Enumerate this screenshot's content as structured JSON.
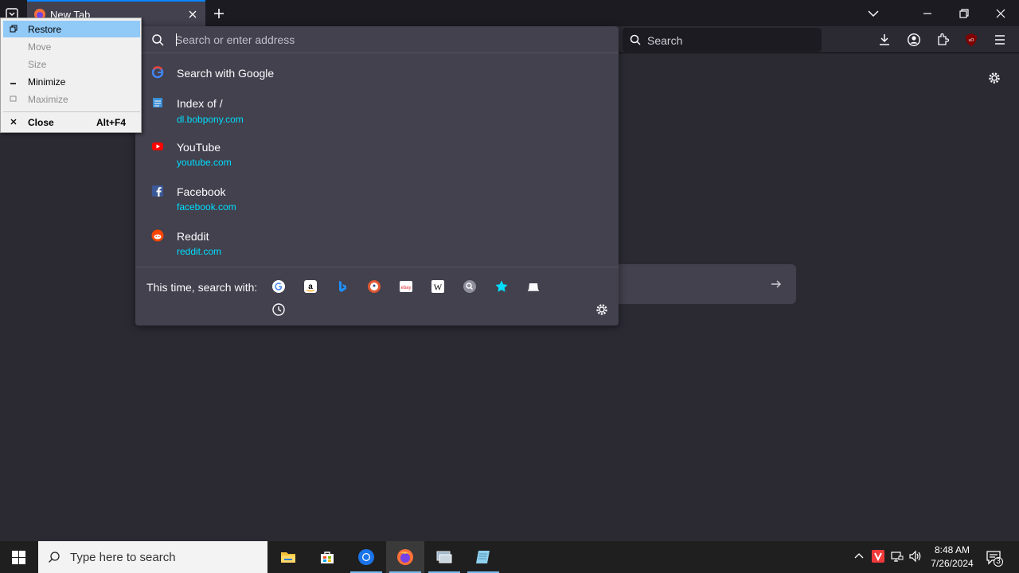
{
  "browser": {
    "tab": {
      "title": "New Tab"
    },
    "toolbar": {
      "search_placeholder": "Search"
    }
  },
  "urlbar": {
    "placeholder": "Search or enter address",
    "results": [
      {
        "title": "Search with Google",
        "url": "",
        "icon": "google-icon"
      },
      {
        "title": "Index of /",
        "url": "dl.bobpony.com",
        "icon": "page-icon"
      },
      {
        "title": "YouTube",
        "url": "youtube.com",
        "icon": "youtube-icon"
      },
      {
        "title": "Facebook",
        "url": "facebook.com",
        "icon": "facebook-icon"
      },
      {
        "title": "Reddit",
        "url": "reddit.com",
        "icon": "reddit-icon"
      }
    ],
    "oneoff_label": "This time, search with:",
    "engines": [
      "google-icon",
      "amazon-icon",
      "bing-icon",
      "duckduckgo-icon",
      "ebay-icon",
      "wikipedia-icon",
      "search-engine-icon",
      "bookmarks-icon",
      "tabs-icon",
      "history-icon"
    ]
  },
  "sysmenu": {
    "items": [
      {
        "label": "Restore",
        "key": "",
        "state": "selected"
      },
      {
        "label": "Move",
        "key": "",
        "state": "disabled"
      },
      {
        "label": "Size",
        "key": "",
        "state": "disabled"
      },
      {
        "label": "Minimize",
        "key": "",
        "state": "enabled"
      },
      {
        "label": "Maximize",
        "key": "",
        "state": "disabled"
      },
      {
        "label": "Close",
        "key": "Alt+F4",
        "state": "enabled"
      }
    ]
  },
  "taskbar": {
    "search_placeholder": "Type here to search",
    "apps": [
      "file-explorer",
      "microsoft-store",
      "chrome",
      "firefox",
      "remote-desktop",
      "notepad"
    ],
    "clock": {
      "time": "8:48 AM",
      "date": "7/26/2024"
    },
    "notification_count": "3"
  },
  "colors": {
    "accent": "#0a84ff",
    "link": "#00ddff",
    "menu_highlight": "#91c9f7"
  }
}
